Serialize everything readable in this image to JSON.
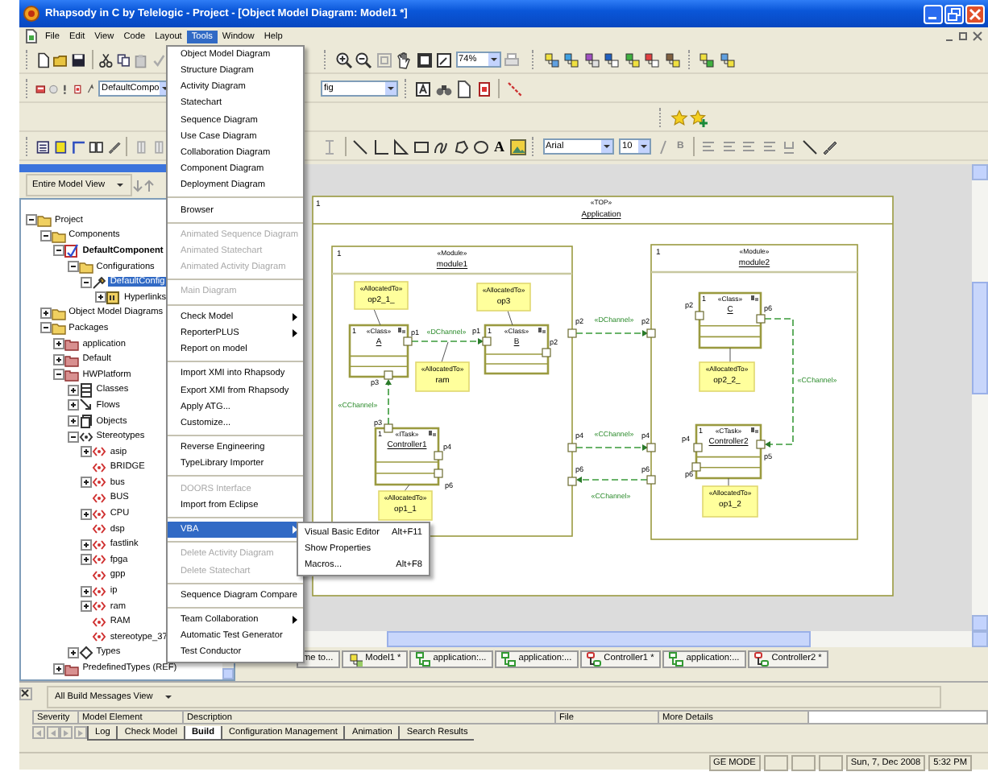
{
  "window": {
    "title": "Rhapsody in C by Telelogic - Project - [Object Model Diagram: Model1 *]"
  },
  "menu_bar": [
    {
      "label": "File",
      "selected": false
    },
    {
      "label": "Edit",
      "selected": false
    },
    {
      "label": "View",
      "selected": false
    },
    {
      "label": "Code",
      "selected": false
    },
    {
      "label": "Layout",
      "selected": false
    },
    {
      "label": "Tools",
      "selected": true
    },
    {
      "label": "Window",
      "selected": false
    },
    {
      "label": "Help",
      "selected": false
    }
  ],
  "toolbars": {
    "zoom": "74%",
    "component": "DefaultCompo",
    "configuration": "fig",
    "text_tool": "A",
    "font": "Arial",
    "font_size": "10",
    "bold_button": "B"
  },
  "tools_menu": [
    [
      {
        "label": "Object Model Diagram",
        "disabled": false,
        "submenu": false,
        "selected": false
      },
      {
        "label": "Structure Diagram",
        "disabled": false,
        "submenu": false,
        "selected": false
      },
      {
        "label": "Activity Diagram",
        "disabled": false,
        "submenu": false,
        "selected": false
      },
      {
        "label": "Statechart",
        "disabled": false,
        "submenu": false,
        "selected": false
      },
      {
        "label": "Sequence Diagram",
        "disabled": false,
        "submenu": false,
        "selected": false
      },
      {
        "label": "Use Case Diagram",
        "disabled": false,
        "submenu": false,
        "selected": false
      },
      {
        "label": "Collaboration Diagram",
        "disabled": false,
        "submenu": false,
        "selected": false
      },
      {
        "label": "Component Diagram",
        "disabled": false,
        "submenu": false,
        "selected": false
      },
      {
        "label": "Deployment Diagram",
        "disabled": false,
        "submenu": false,
        "selected": false
      }
    ],
    [
      {
        "label": "Browser",
        "disabled": false,
        "submenu": false,
        "selected": false
      }
    ],
    [
      {
        "label": "Animated Sequence Diagram",
        "disabled": true,
        "submenu": false,
        "selected": false
      },
      {
        "label": "Animated Statechart",
        "disabled": true,
        "submenu": false,
        "selected": false
      },
      {
        "label": "Animated Activity Diagram",
        "disabled": true,
        "submenu": false,
        "selected": false
      }
    ],
    [
      {
        "label": "Main Diagram",
        "disabled": true,
        "submenu": false,
        "selected": false
      }
    ],
    [
      {
        "label": "Check Model",
        "disabled": false,
        "submenu": true,
        "selected": false
      },
      {
        "label": "ReporterPLUS",
        "disabled": false,
        "submenu": true,
        "selected": false
      },
      {
        "label": "Report on model",
        "disabled": false,
        "submenu": false,
        "selected": false
      }
    ],
    [
      {
        "label": "Import XMI into Rhapsody",
        "disabled": false,
        "submenu": false,
        "selected": false
      },
      {
        "label": "Export XMI from Rhapsody",
        "disabled": false,
        "submenu": false,
        "selected": false
      },
      {
        "label": "Apply ATG...",
        "disabled": false,
        "submenu": false,
        "selected": false
      },
      {
        "label": "Customize...",
        "disabled": false,
        "submenu": false,
        "selected": false
      }
    ],
    [
      {
        "label": "Reverse Engineering",
        "disabled": false,
        "submenu": false,
        "selected": false
      },
      {
        "label": "TypeLibrary Importer",
        "disabled": false,
        "submenu": false,
        "selected": false
      }
    ],
    [
      {
        "label": "DOORS Interface",
        "disabled": true,
        "submenu": false,
        "selected": false
      },
      {
        "label": "Import from Eclipse",
        "disabled": false,
        "submenu": false,
        "selected": false
      }
    ],
    [
      {
        "label": "VBA",
        "disabled": false,
        "submenu": true,
        "selected": true
      }
    ],
    [
      {
        "label": "Delete Activity Diagram",
        "disabled": true,
        "submenu": false,
        "selected": false
      },
      {
        "label": "Delete Statechart",
        "disabled": true,
        "submenu": false,
        "selected": false
      }
    ],
    [
      {
        "label": "Sequence Diagram Compare",
        "disabled": false,
        "submenu": false,
        "selected": false
      }
    ],
    [
      {
        "label": "Team Collaboration",
        "disabled": false,
        "submenu": true,
        "selected": false
      },
      {
        "label": "Automatic Test Generator",
        "disabled": false,
        "submenu": false,
        "selected": false
      },
      {
        "label": "Test Conductor",
        "disabled": false,
        "submenu": false,
        "selected": false
      }
    ]
  ],
  "vba_submenu": [
    {
      "label": "Visual Basic Editor",
      "shortcut": "Alt+F11"
    },
    {
      "label": "Show Properties"
    },
    {
      "label": "Macros...",
      "shortcut": "Alt+F8"
    }
  ],
  "browser": {
    "view": "Entire Model View",
    "tree": [
      {
        "label": "Project",
        "kind": "folder",
        "expanded": true,
        "selected": false,
        "bold": false,
        "children": [
          {
            "label": "Components",
            "kind": "folder",
            "expanded": true,
            "selected": false,
            "bold": false,
            "children": [
              {
                "label": "DefaultComponent",
                "kind": "component",
                "expanded": true,
                "selected": false,
                "bold": true,
                "children": [
                  {
                    "label": "Configurations",
                    "kind": "folder",
                    "expanded": true,
                    "selected": false,
                    "bold": false,
                    "children": [
                      {
                        "label": "DefaultConfig",
                        "kind": "configuration",
                        "expanded": true,
                        "selected": true,
                        "bold": false,
                        "children": [
                          {
                            "label": "Hyperlinks",
                            "kind": "hyperlinks",
                            "expanded": false,
                            "selected": false,
                            "bold": false
                          }
                        ]
                      }
                    ]
                  }
                ]
              }
            ]
          },
          {
            "label": "Object Model Diagrams",
            "kind": "folder",
            "expanded": false,
            "selected": false,
            "bold": false
          },
          {
            "label": "Packages",
            "kind": "folder",
            "expanded": true,
            "selected": false,
            "bold": false,
            "children": [
              {
                "label": "application",
                "kind": "package",
                "expanded": false,
                "selected": false,
                "bold": false
              },
              {
                "label": "Default",
                "kind": "package",
                "expanded": false,
                "selected": false,
                "bold": false
              },
              {
                "label": "HWPlatform",
                "kind": "package",
                "expanded": true,
                "selected": false,
                "bold": false,
                "children": [
                  {
                    "label": "Classes",
                    "kind": "classes",
                    "expanded": false,
                    "selected": false,
                    "bold": false
                  },
                  {
                    "label": "Flows",
                    "kind": "flows",
                    "expanded": false,
                    "selected": false,
                    "bold": false
                  },
                  {
                    "label": "Objects",
                    "kind": "objects",
                    "expanded": false,
                    "selected": false,
                    "bold": false
                  },
                  {
                    "label": "Stereotypes",
                    "kind": "stereotypes",
                    "expanded": true,
                    "selected": false,
                    "bold": false,
                    "children": [
                      {
                        "label": "asip",
                        "kind": "stereotype",
                        "expanded": false,
                        "selected": false,
                        "bold": false
                      },
                      {
                        "label": "BRIDGE",
                        "kind": "stereotype",
                        "selected": false,
                        "bold": false
                      },
                      {
                        "label": "bus",
                        "kind": "stereotype",
                        "expanded": false,
                        "selected": false,
                        "bold": false
                      },
                      {
                        "label": "BUS",
                        "kind": "stereotype",
                        "selected": false,
                        "bold": false
                      },
                      {
                        "label": "CPU",
                        "kind": "stereotype",
                        "expanded": false,
                        "selected": false,
                        "bold": false
                      },
                      {
                        "label": "dsp",
                        "kind": "stereotype",
                        "selected": false,
                        "bold": false
                      },
                      {
                        "label": "fastlink",
                        "kind": "stereotype",
                        "expanded": false,
                        "selected": false,
                        "bold": false
                      },
                      {
                        "label": "fpga",
                        "kind": "stereotype",
                        "expanded": false,
                        "selected": false,
                        "bold": false
                      },
                      {
                        "label": "gpp",
                        "kind": "stereotype",
                        "selected": false,
                        "bold": false
                      },
                      {
                        "label": "ip",
                        "kind": "stereotype",
                        "expanded": false,
                        "selected": false,
                        "bold": false
                      },
                      {
                        "label": "ram",
                        "kind": "stereotype",
                        "expanded": false,
                        "selected": false,
                        "bold": false
                      },
                      {
                        "label": "RAM",
                        "kind": "stereotype",
                        "selected": false,
                        "bold": false
                      },
                      {
                        "label": "stereotype_37",
                        "kind": "stereotype",
                        "selected": false,
                        "bold": false
                      }
                    ]
                  },
                  {
                    "label": "Types",
                    "kind": "types",
                    "expanded": false,
                    "selected": false,
                    "bold": false
                  }
                ]
              },
              {
                "label": "PredefinedTypes (REF)",
                "kind": "package",
                "expanded": false,
                "selected": false,
                "bold": false
              }
            ]
          }
        ]
      }
    ]
  },
  "diagram": {
    "top": {
      "multiplicity": "1",
      "stereotype": "«TOP»",
      "name": "Application"
    },
    "modules": [
      {
        "multiplicity": "1",
        "stereotype": "«Module»",
        "name": "module1"
      },
      {
        "multiplicity": "1",
        "stereotype": "«Module»",
        "name": "module2"
      }
    ],
    "classes": [
      {
        "multiplicity": "1",
        "stereotype": "«Class»",
        "name": "A"
      },
      {
        "multiplicity": "1",
        "stereotype": "«Class»",
        "name": "B"
      },
      {
        "multiplicity": "1",
        "stereotype": "«ITask»",
        "name": "Controller1"
      },
      {
        "multiplicity": "1",
        "stereotype": "«Class»",
        "name": "C"
      },
      {
        "multiplicity": "1",
        "stereotype": "«CTask»",
        "name": "Controller2"
      }
    ],
    "notes": [
      {
        "stereotype": "«AllocatedTo»",
        "name": "op2_1_"
      },
      {
        "stereotype": "«AllocatedTo»",
        "name": "op3"
      },
      {
        "stereotype": "«AllocatedTo»",
        "name": "ram"
      },
      {
        "stereotype": "«AllocatedTo»",
        "name": "op1_1"
      },
      {
        "stereotype": "«AllocatedTo»",
        "name": "op2_2_"
      },
      {
        "stereotype": "«AllocatedTo»",
        "name": "op1_2"
      }
    ],
    "ports": [
      "p1",
      "p1",
      "p2",
      "p3",
      "p3",
      "p4",
      "p6",
      "p2",
      "p4",
      "p6",
      "p2",
      "p4",
      "p6",
      "p2",
      "p6",
      "p4",
      "p5",
      "p6"
    ],
    "channels": [
      "«DChannel»",
      "«CChannel»",
      "«DChannel»",
      "«CChannel»",
      "«CChannel»",
      "«CChannel»"
    ]
  },
  "document_tabs": [
    {
      "label": "me to..."
    },
    {
      "label": "Model1 *",
      "kind": "model"
    },
    {
      "label": "application:...",
      "kind": "object"
    },
    {
      "label": "application:...",
      "kind": "object"
    },
    {
      "label": "Controller1 *",
      "kind": "statechart"
    },
    {
      "label": "application:...",
      "kind": "object"
    },
    {
      "label": "Controller2 *",
      "kind": "statechart"
    }
  ],
  "output": {
    "view": "All Build Messages View",
    "columns": [
      "Severity",
      "Model Element",
      "Description",
      "File",
      "More Details"
    ],
    "tabs": [
      {
        "label": "Log",
        "selected": false
      },
      {
        "label": "Check Model",
        "selected": false
      },
      {
        "label": "Build",
        "selected": true
      },
      {
        "label": "Configuration Management",
        "selected": false
      },
      {
        "label": "Animation",
        "selected": false
      },
      {
        "label": "Search Results",
        "selected": false
      }
    ]
  },
  "status_bar": {
    "mode": "GE MODE",
    "date": "Sun, 7, Dec 2008",
    "time": "5:32 PM"
  }
}
